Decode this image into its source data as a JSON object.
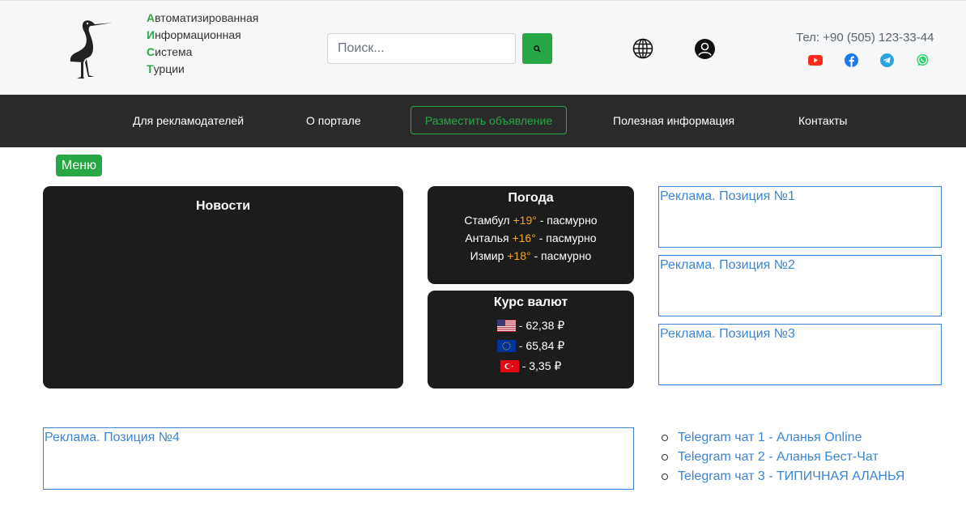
{
  "header": {
    "title_lines": [
      {
        "first": "А",
        "rest": "втоматизированная"
      },
      {
        "first": "И",
        "rest": "нформационная"
      },
      {
        "first": "С",
        "rest": "истема"
      },
      {
        "first": "Т",
        "rest": "урции"
      }
    ],
    "search_placeholder": "Поиск...",
    "phone": "Тел: +90 (505) 123-33-44",
    "social_icons": [
      "youtube-icon",
      "facebook-icon",
      "telegram-icon",
      "whatsapp-icon"
    ]
  },
  "nav": {
    "items": [
      "Для рекламодателей",
      "О портале",
      "Разместить объявление",
      "Полезная информация",
      "Контакты"
    ]
  },
  "menu_label": "Меню",
  "news": {
    "title": "Новости"
  },
  "weather": {
    "title": "Погода",
    "rows": [
      {
        "city": "Стамбул",
        "temp": "+19°",
        "desc": "- пасмурно"
      },
      {
        "city": "Анталья",
        "temp": "+16°",
        "desc": "- пасмурно"
      },
      {
        "city": "Измир",
        "temp": "+18°",
        "desc": "- пасмурно"
      }
    ]
  },
  "currency": {
    "title": "Курс валют",
    "rows": [
      {
        "flag": "usa-flag-icon",
        "value": "- 62,38 ₽"
      },
      {
        "flag": "eu-flag-icon",
        "value": "- 65,84 ₽"
      },
      {
        "flag": "turkey-flag-icon",
        "value": "- 3,35 ₽"
      }
    ]
  },
  "ads": [
    "Реклама. Позиция №1",
    "Реклама. Позиция №2",
    "Реклама. Позиция №3",
    "Реклама. Позиция №4"
  ],
  "telegram_links": [
    "Telegram чат 1 - Аланья Online",
    "Telegram чат 2 - Аланья Бест-Чат",
    "Telegram чат 3 - ТИПИЧНАЯ АЛАНЬЯ"
  ],
  "colors": {
    "accent_green": "#28a745",
    "link_blue": "#3a86d4",
    "temp_orange": "#f5a623",
    "panel_dark": "#1c1c1c",
    "nav_dark": "#2b2b2b"
  }
}
